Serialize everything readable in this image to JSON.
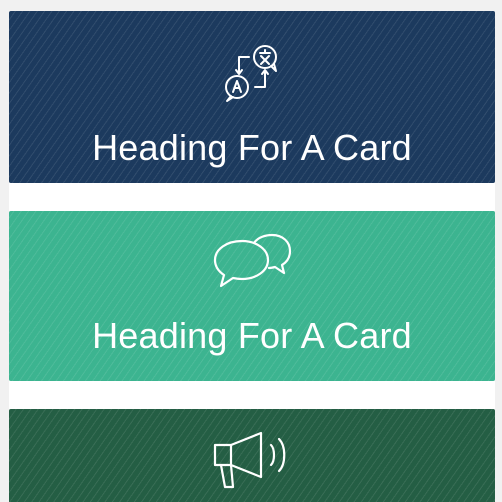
{
  "cards": [
    {
      "heading": "Heading For A Card",
      "icon": "translate-icon",
      "color": "#1c3a5e"
    },
    {
      "heading": "Heading For A Card",
      "icon": "chat-bubbles-icon",
      "color": "#3cb490"
    },
    {
      "heading": "",
      "icon": "megaphone-icon",
      "color": "#245e44"
    }
  ]
}
